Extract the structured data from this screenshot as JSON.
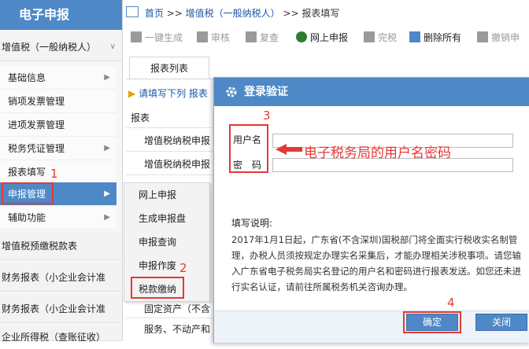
{
  "sidebar": {
    "app_title": "电子申报",
    "groups": [
      {
        "label": "增值税（一般纳税人）",
        "arrow": "∨"
      },
      {
        "label": "增值税预缴税款表",
        "arrow": ""
      },
      {
        "label": "财务报表（小企业会计准",
        "arrow": ""
      },
      {
        "label": "财务报表（小企业会计准",
        "arrow": ""
      },
      {
        "label": "企业所得税（查账征收）",
        "arrow": ""
      }
    ],
    "items": [
      {
        "label": "基础信息"
      },
      {
        "label": "销项发票管理"
      },
      {
        "label": "进项发票管理"
      },
      {
        "label": "税务凭证管理"
      },
      {
        "label": "报表填写"
      },
      {
        "label": "申报管理"
      },
      {
        "label": "辅助功能"
      }
    ]
  },
  "submenu": {
    "items": [
      "网上申报",
      "生成申报盘",
      "申报查询",
      "申报作废",
      "税款缴纳"
    ]
  },
  "breadcrumb": {
    "home": "首页",
    "sep": ">>",
    "level1": "增值税（一般纳税人）",
    "level2": "报表填写"
  },
  "toolbar": {
    "items": [
      "一键生成",
      "审核",
      "复查",
      "网上申报",
      "完税",
      "删除所有",
      "撤销申"
    ]
  },
  "tabs": {
    "list_label": "报表列表"
  },
  "main": {
    "hint": "请填写下列 报表",
    "column_header": "报表",
    "rows": [
      "增值税纳税申报",
      "增值税纳税申报",
      "",
      "",
      "",
      "",
      "固定资产（不含",
      "服务、不动产和"
    ]
  },
  "dialog": {
    "title": "登录验证",
    "username_label": "用户名",
    "password_label": "密　码",
    "username_value": "",
    "password_value": "",
    "help_title": "填写说明:",
    "help_text": "2017年1月1日起，广东省(不含深圳)国税部门将全面实行税收实名制管理，办税人员须按规定办理实名采集后，才能办理相关涉税事项。请您输入广东省电子税务局实名登记的用户名和密码进行报表发送。如您还未进行实名认证，请前往所属税务机关咨询办理。",
    "ok_label": "确定",
    "close_label": "关闭"
  },
  "annotations": {
    "n1": "1",
    "n2": "2",
    "n3": "3",
    "n4": "4",
    "note": "电子税务局的用户名密码",
    "color": "#e53935"
  },
  "colors": {
    "accent": "#4f88c6",
    "link": "#1a56a8"
  }
}
